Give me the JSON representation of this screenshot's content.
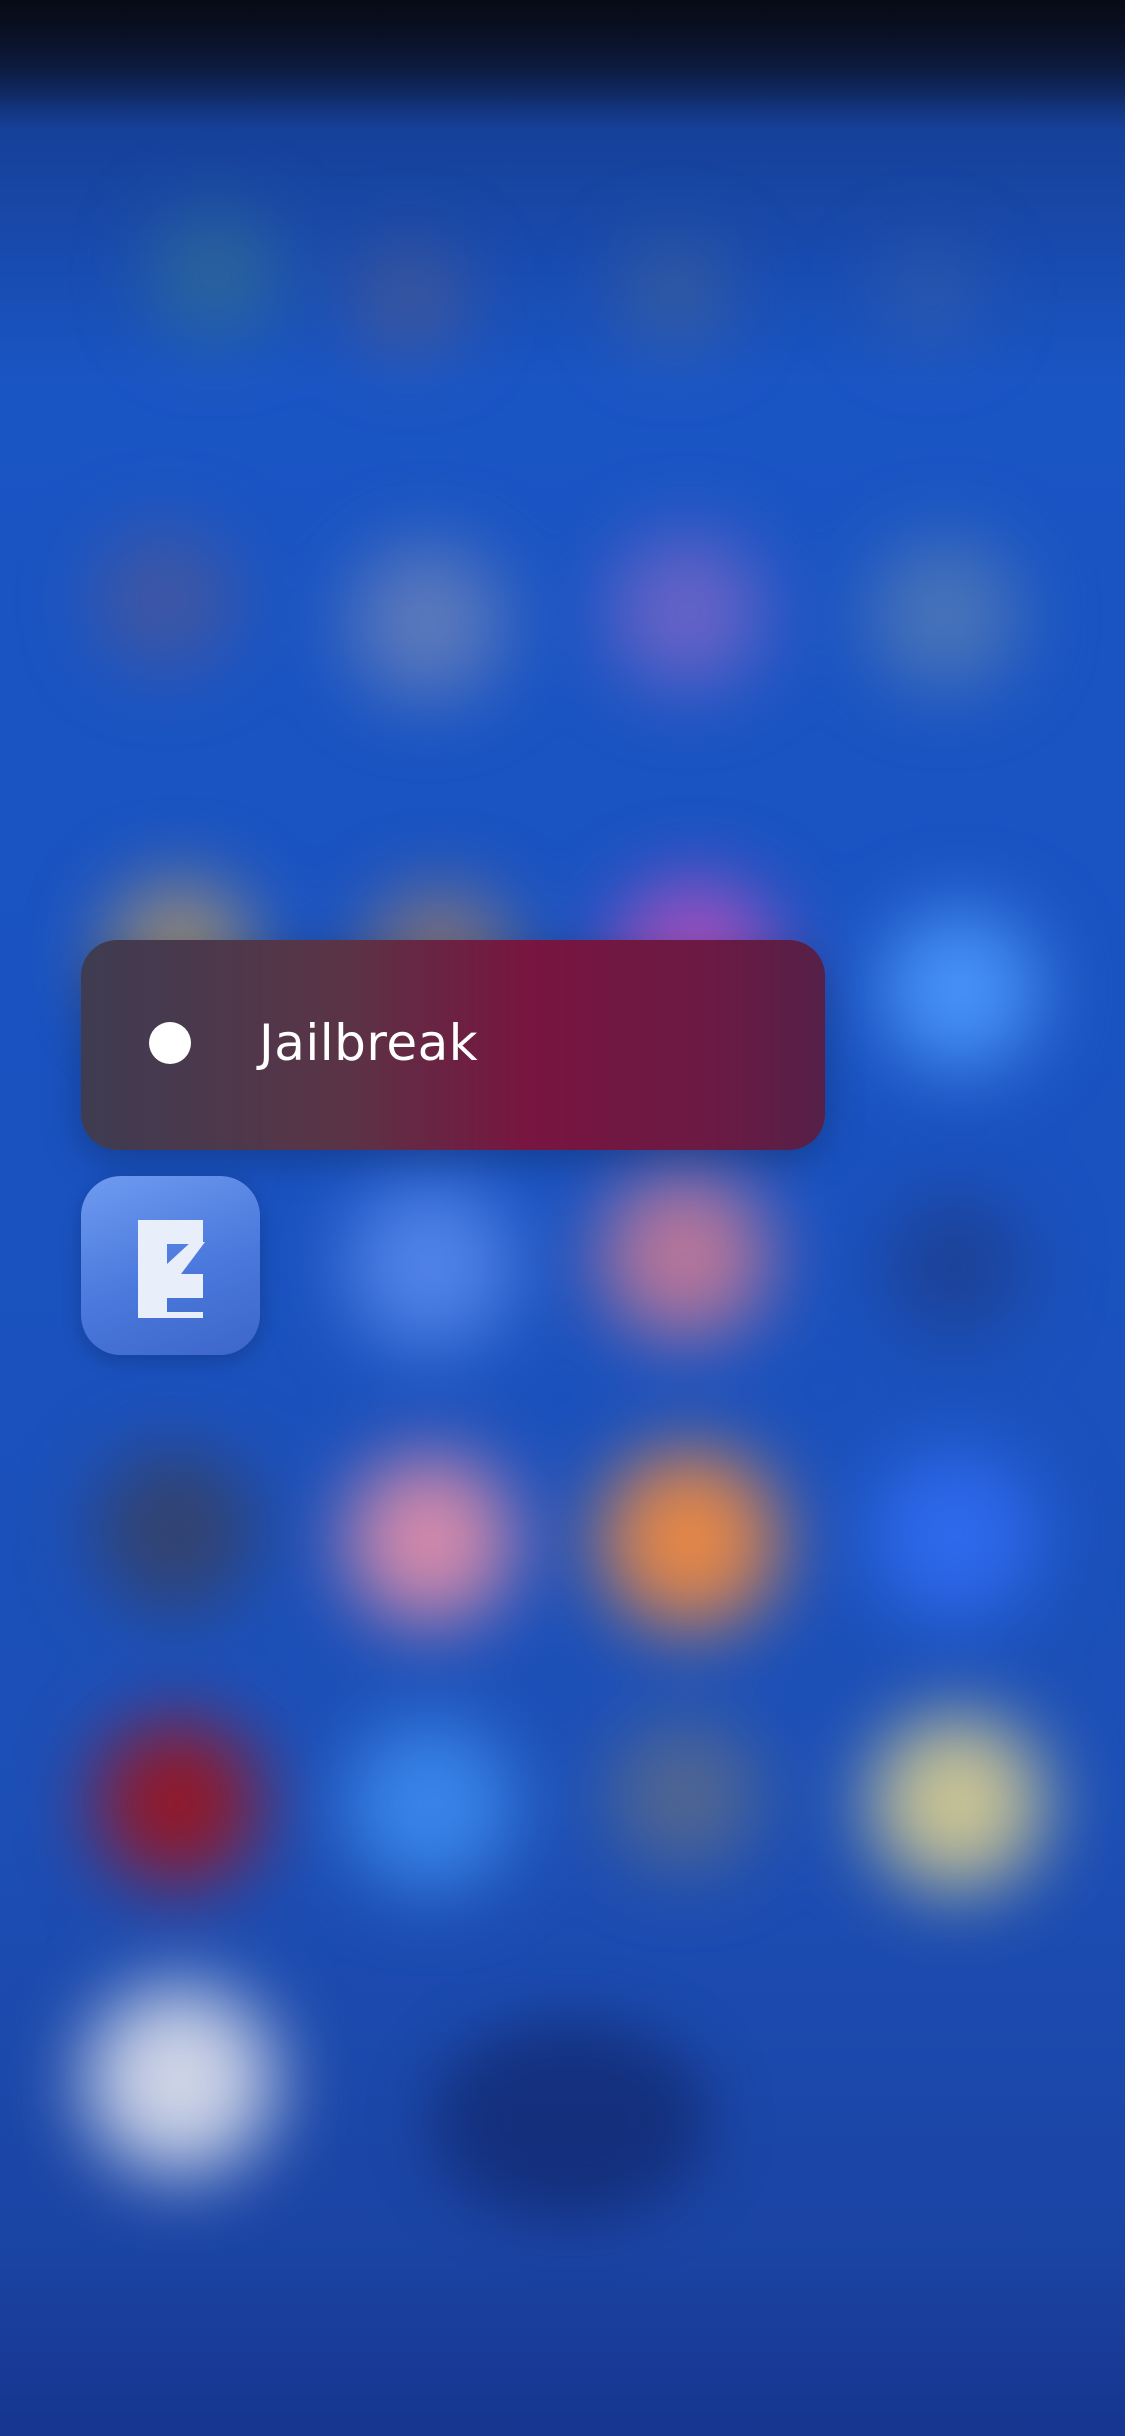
{
  "context_menu": {
    "items": [
      {
        "label": "Jailbreak",
        "icon": "filled-circle-icon"
      }
    ]
  },
  "focused_app": {
    "icon": "electra-e-logo-icon",
    "accent_color": "#4a78dc"
  },
  "colors": {
    "wallpaper": "#1a52c0",
    "menu_tint": "#781540"
  }
}
